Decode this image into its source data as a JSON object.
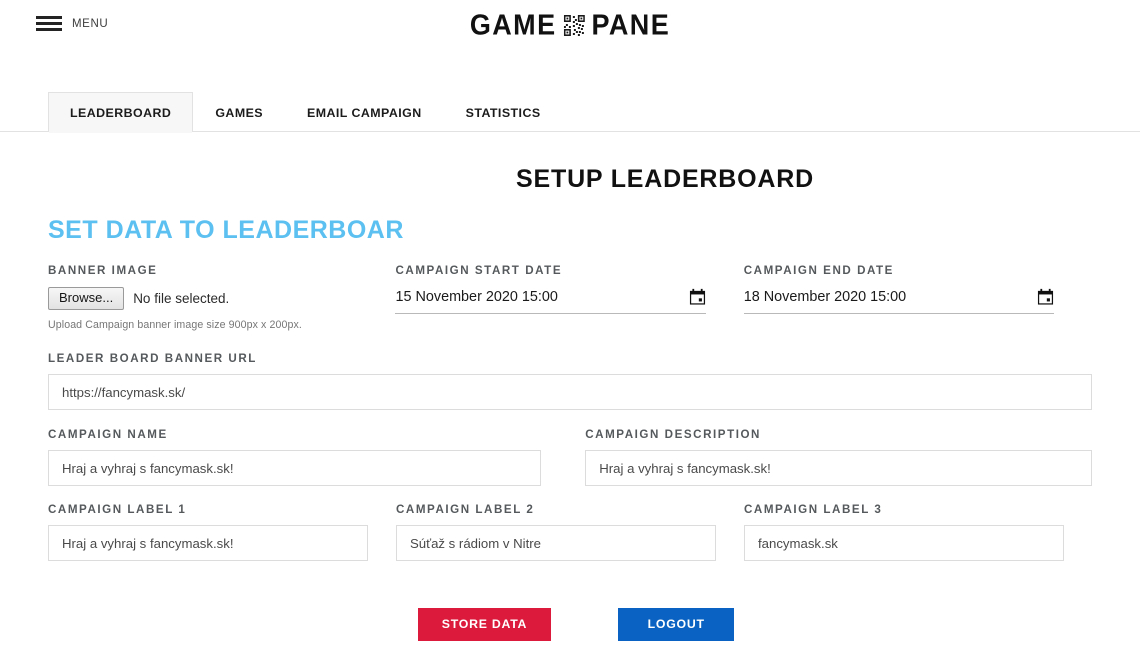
{
  "header": {
    "menu_label": "MENU",
    "menu_icon": "hamburger-icon",
    "brand_left": "GAME",
    "brand_right": "PANE",
    "brand_icon": "qr-code-icon"
  },
  "tabs": [
    {
      "label": "LEADERBOARD",
      "active": true
    },
    {
      "label": "GAMES",
      "active": false
    },
    {
      "label": "EMAIL CAMPAIGN",
      "active": false
    },
    {
      "label": "STATISTICS",
      "active": false
    }
  ],
  "titles": {
    "main": "SETUP LEADERBOARD",
    "sub": "SET DATA TO LEADERBOAR"
  },
  "form": {
    "banner_image": {
      "label": "BANNER IMAGE",
      "browse_button": "Browse...",
      "file_status": "No file selected.",
      "hint": "Upload Campaign banner image size 900px x 200px."
    },
    "start_date": {
      "label": "CAMPAIGN START DATE",
      "value": "15 November 2020 15:00",
      "icon": "calendar-icon"
    },
    "end_date": {
      "label": "CAMPAIGN END DATE",
      "value": "18 November 2020 15:00",
      "icon": "calendar-icon"
    },
    "banner_url": {
      "label": "LEADER BOARD BANNER URL",
      "value": "https://fancymask.sk/"
    },
    "campaign_name": {
      "label": "CAMPAIGN NAME",
      "value": "Hraj a vyhraj s fancymask.sk!"
    },
    "campaign_description": {
      "label": "CAMPAIGN DESCRIPTION",
      "value": "Hraj a vyhraj s fancymask.sk!"
    },
    "label_1": {
      "label": "CAMPAIGN LABEL 1",
      "value": "Hraj a vyhraj s fancymask.sk!"
    },
    "label_2": {
      "label": "CAMPAIGN LABEL 2",
      "value": "Súťaž s rádiom v Nitre"
    },
    "label_3": {
      "label": "CAMPAIGN LABEL 3",
      "value": "fancymask.sk"
    }
  },
  "actions": {
    "store": "STORE DATA",
    "logout": "LOGOUT"
  },
  "colors": {
    "accent_blue_light": "#5cc0f0",
    "store_red": "#dc1b3c",
    "logout_blue": "#0a63c2",
    "label_gray": "#55595c"
  }
}
